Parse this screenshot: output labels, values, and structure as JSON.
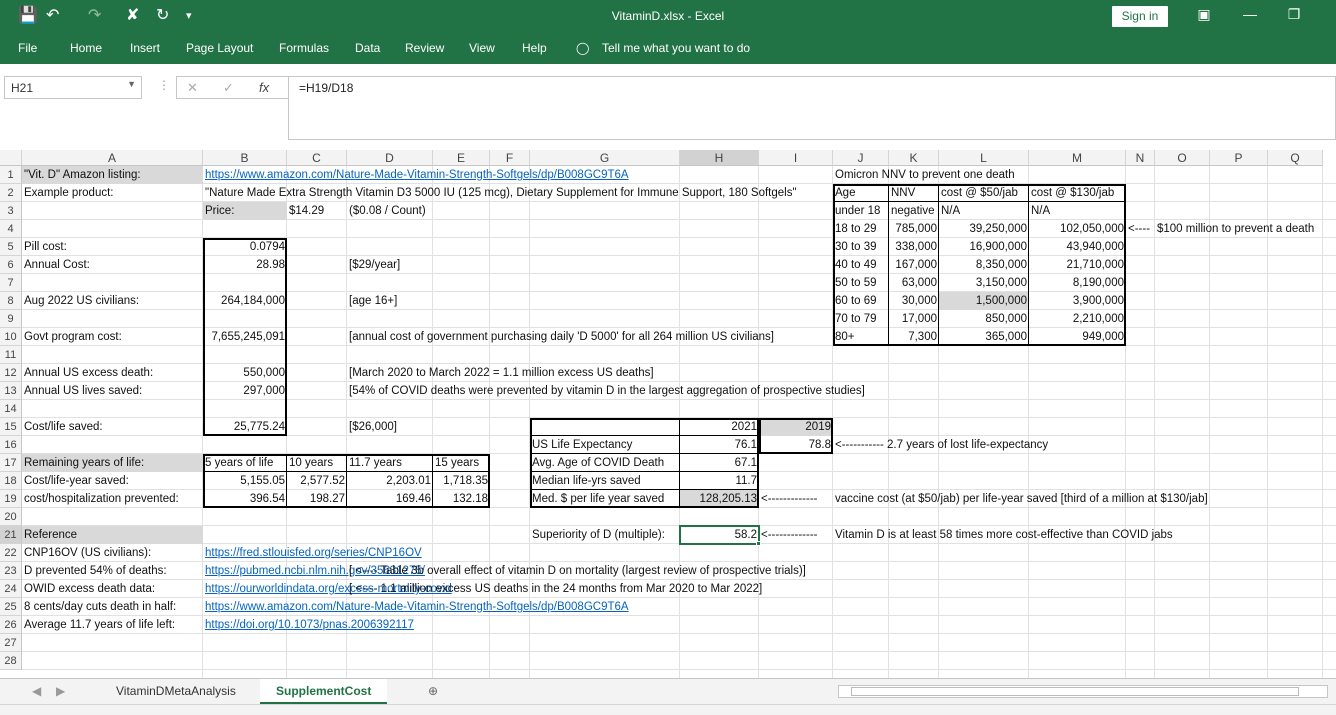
{
  "titlebar": {
    "title": "VitaminD.xlsx  -  Excel",
    "sign_in": "Sign in"
  },
  "ribbon": {
    "tabs": [
      "File",
      "Home",
      "Insert",
      "Page Layout",
      "Formulas",
      "Data",
      "Review",
      "View",
      "Help"
    ],
    "tell_me": "Tell me what you want to do"
  },
  "formula_bar": {
    "name_box": "H21",
    "formula": "=H19/D18"
  },
  "columns": [
    "A",
    "B",
    "C",
    "D",
    "E",
    "F",
    "G",
    "H",
    "I",
    "J",
    "K",
    "L",
    "M",
    "N",
    "O",
    "P",
    "Q"
  ],
  "rows": [
    "1",
    "2",
    "3",
    "4",
    "5",
    "6",
    "7",
    "8",
    "9",
    "10",
    "11",
    "12",
    "13",
    "14",
    "15",
    "16",
    "17",
    "18",
    "19",
    "20",
    "21",
    "22",
    "23",
    "24",
    "25",
    "26",
    "27",
    "28"
  ],
  "cells": {
    "A1": "\"Vit. D\" Amazon listing:",
    "B1": "https://www.amazon.com/Nature-Made-Vitamin-Strength-Softgels/dp/B008GC9T6A",
    "A2": "Example product:",
    "B2": "\"Nature Made Extra Strength Vitamin D3 5000 IU (125 mcg), Dietary Supplement for Immune Support, 180 Softgels\"",
    "B3": "Price:",
    "C3": "$14.29",
    "D3": "($0.08 / Count)",
    "A5": "Pill cost:",
    "B5": "0.0794",
    "A6": "Annual Cost:",
    "B6": "28.98",
    "D6": "[$29/year]",
    "A8": "Aug 2022 US civilians:",
    "B8": "264,184,000",
    "D8": "[age 16+]",
    "A10": "Govt program cost:",
    "B10": "7,655,245,091",
    "D10": "[annual cost of government purchasing daily 'D 5000' for all 264 million US civilians]",
    "A12": "Annual US excess death:",
    "B12": "550,000",
    "D12": "[March 2020 to March 2022 = 1.1 million excess US deaths]",
    "A13": "Annual US lives saved:",
    "B13": "297,000",
    "D13": "[54% of COVID deaths were prevented by vitamin D in the largest aggregation of prospective studies]",
    "A15": "Cost/life saved:",
    "B15": "25,775.24",
    "D15": "[$26,000]",
    "A17": "Remaining years of life:",
    "B17": "5 years of life",
    "C17": "10 years",
    "D17": "11.7 years",
    "E17": "15 years",
    "A18": "Cost/life-year saved:",
    "B18": "5,155.05",
    "C18": "2,577.52",
    "D18": "2,203.01",
    "E18": "1,718.35",
    "A19": "cost/hospitalization prevented:",
    "B19": "396.54",
    "C19": "198.27",
    "D19": "169.46",
    "E19": "132.18",
    "H15": "2021",
    "I15": "2019",
    "G16": "US Life Expectancy",
    "H16": "76.1",
    "I16": "78.8",
    "J16": "<----------- 2.7 years of lost life-expectancy",
    "G17": "Avg. Age of COVID Death",
    "H17": "67.1",
    "G18": "Median life-yrs saved",
    "H18": "11.7",
    "G19": "Med. $ per life year saved",
    "H19": "128,205.13",
    "I19": "<-------------",
    "J19": "vaccine cost (at $50/jab) per life-year saved [third of a million at $130/jab]",
    "G21": "Superiority of D (multiple):",
    "H21": "58.2",
    "I21": "<-------------",
    "J21": "Vitamin D is at least 58 times more cost-effective than COVID jabs",
    "A21": "Reference",
    "A22": "CNP16OV (US civilians):",
    "B22": "https://fred.stlouisfed.org/series/CNP16OV",
    "A23": "D prevented 54% of deaths:",
    "B23": "https://pubmed.ncbi.nlm.nih.gov/35631275/",
    "D23": "[ <---- Table 3b overall effect of vitamin D on mortality (largest review of prospective trials)]",
    "A24": "OWID excess death data:",
    "B24": "https://ourworldindata.org/excess-mortality-covid",
    "D24": "[ <---- 1.1 million excess US deaths in the 24 months from Mar 2020 to Mar 2022]",
    "A25": "8 cents/day cuts death in half:",
    "B25": "https://www.amazon.com/Nature-Made-Vitamin-Strength-Softgels/dp/B008GC9T6A",
    "A26": "Average 11.7 years of life left:",
    "B26": "https://doi.org/10.1073/pnas.2006392117",
    "J1": "Omicron NNV to prevent one death",
    "J2": "Age",
    "K2": "NNV",
    "L2": "cost @ $50/jab",
    "M2": "cost @ $130/jab",
    "J3": "under 18",
    "K3": "negative",
    "L3": "N/A",
    "M3": "N/A",
    "J4": "18 to 29",
    "K4": "785,000",
    "L4": "39,250,000",
    "M4": "102,050,000",
    "N4": "<----",
    "O4": "$100 million to prevent a death",
    "J5": "30 to 39",
    "K5": "338,000",
    "L5": "16,900,000",
    "M5": "43,940,000",
    "J6": "40 to 49",
    "K6": "167,000",
    "L6": "8,350,000",
    "M6": "21,710,000",
    "J7": "50 to 59",
    "K7": "63,000",
    "L7": "3,150,000",
    "M7": "8,190,000",
    "J8": "60 to 69",
    "K8": "30,000",
    "L8": "1,500,000",
    "M8": "3,900,000",
    "J9": "70 to 79",
    "K9": "17,000",
    "L9": "850,000",
    "M9": "2,210,000",
    "J10": "80+",
    "K10": "7,300",
    "L10": "365,000",
    "M10": "949,000"
  },
  "sheet_tabs": {
    "tabs": [
      "VitaminDMetaAnalysis",
      "SupplementCost"
    ],
    "active": "SupplementCost"
  },
  "colors": {
    "brand": "#217346",
    "link": "#0563c1",
    "grey_fill": "#d9d9d9"
  }
}
